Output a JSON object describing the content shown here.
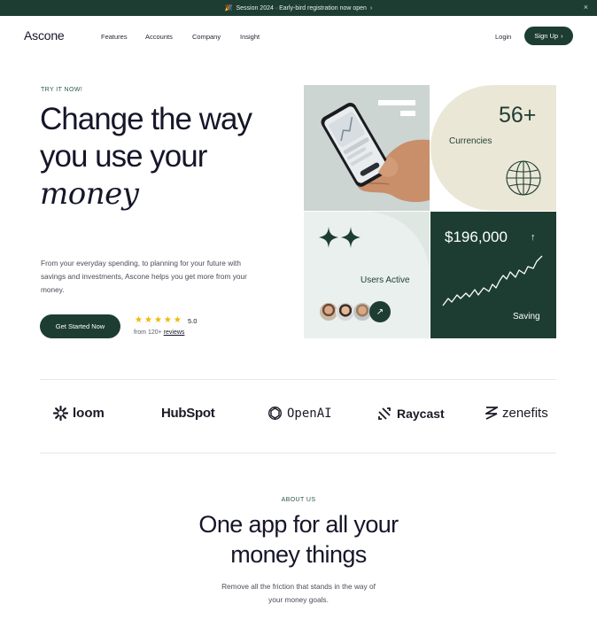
{
  "announcement": {
    "icon": "party-popper-icon",
    "text": "Session 2024 · Early-bird registration now open",
    "arrow": "›",
    "close": "×"
  },
  "nav": {
    "logo": "Ascone",
    "links": [
      "Features",
      "Accounts",
      "Company",
      "Insight"
    ],
    "login": "Login",
    "signup": "Sign Up",
    "signup_arrow": "›"
  },
  "hero": {
    "eyebrow": "TRY IT NOW!",
    "headline_line1": "Change the way",
    "headline_line2": "you use your",
    "headline_line3": "money",
    "subtext": "From your everyday spending, to planning for your future with savings and investments, Ascone helps you get more from your money.",
    "cta": "Get Started Now",
    "rating": "5.0",
    "stars": 5,
    "reviews_prefix": "from 120+",
    "reviews_link": "reviews"
  },
  "collage": {
    "currencies_count": "56+",
    "currencies_label": "Currencies",
    "users_label": "Users Active",
    "saving_amount": "$196,000",
    "saving_label": "Saving"
  },
  "brands": [
    "loom",
    "HubSpot",
    "OpenAI",
    "Raycast",
    "zenefits"
  ],
  "about": {
    "eyebrow": "ABOUT US",
    "heading_line1": "One app for all your",
    "heading_line2": "money things",
    "text_line1": "Remove all the friction that stands in the way of",
    "text_line2": "your money goals."
  },
  "colors": {
    "brand_green": "#1d3d33",
    "cream": "#ebe7d6",
    "mint": "#eaf0ed",
    "star": "#f2b705"
  }
}
